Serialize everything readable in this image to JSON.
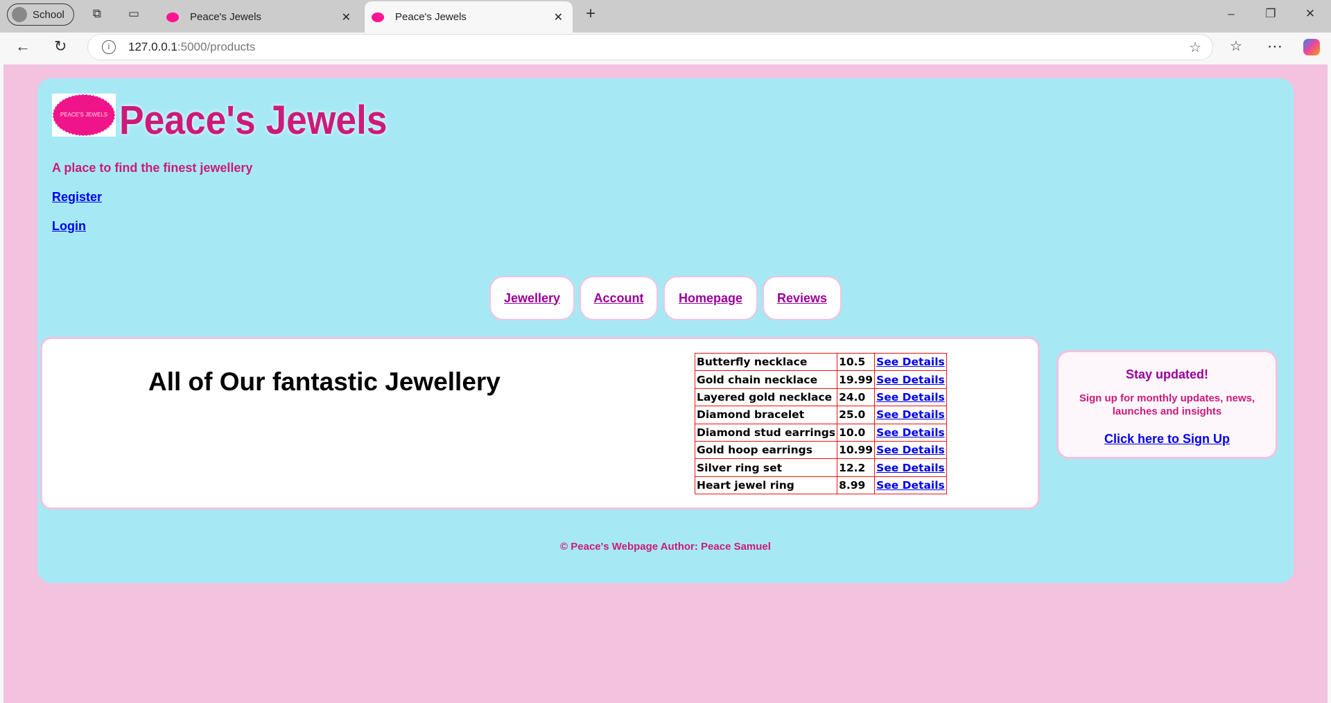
{
  "browser": {
    "profile": "School",
    "tabs": [
      {
        "title": "Peace's Jewels"
      },
      {
        "title": "Peace's Jewels"
      }
    ],
    "url_host": "127.0.0.1",
    "url_rest": ":5000/products"
  },
  "header": {
    "logo_text": "PEACE'S JEWELS",
    "title": "Peace's Jewels",
    "tagline": "A place to find the finest jewellery",
    "links": [
      "Register",
      "Login"
    ]
  },
  "nav": [
    "Jewellery",
    "Account",
    "Homepage",
    "Reviews"
  ],
  "main": {
    "heading": "All of Our fantastic Jewellery",
    "products": [
      {
        "name": "Butterfly necklace",
        "price": "10.5",
        "link": "See Details"
      },
      {
        "name": "Gold chain necklace",
        "price": "19.99",
        "link": "See Details"
      },
      {
        "name": "Layered gold necklace",
        "price": "24.0",
        "link": "See Details"
      },
      {
        "name": "Diamond bracelet",
        "price": "25.0",
        "link": "See Details"
      },
      {
        "name": "Diamond stud earrings",
        "price": "10.0",
        "link": "See Details"
      },
      {
        "name": "Gold hoop earrings",
        "price": "10.99",
        "link": "See Details"
      },
      {
        "name": "Silver ring set",
        "price": "12.2",
        "link": "See Details"
      },
      {
        "name": "Heart jewel ring",
        "price": "8.99",
        "link": "See Details"
      }
    ]
  },
  "sidebar": {
    "title": "Stay updated!",
    "text": "Sign up for monthly updates, news, launches and insights",
    "link": "Click here to Sign Up"
  },
  "footer": "© Peace's Webpage Author: Peace Samuel",
  "colors": {
    "page_bg": "#f2c2df",
    "container_bg": "#a6e9f5",
    "brand": "#cc1a7a",
    "nav_link": "#990099",
    "link": "#0000ee",
    "table_border": "#ee1111"
  }
}
